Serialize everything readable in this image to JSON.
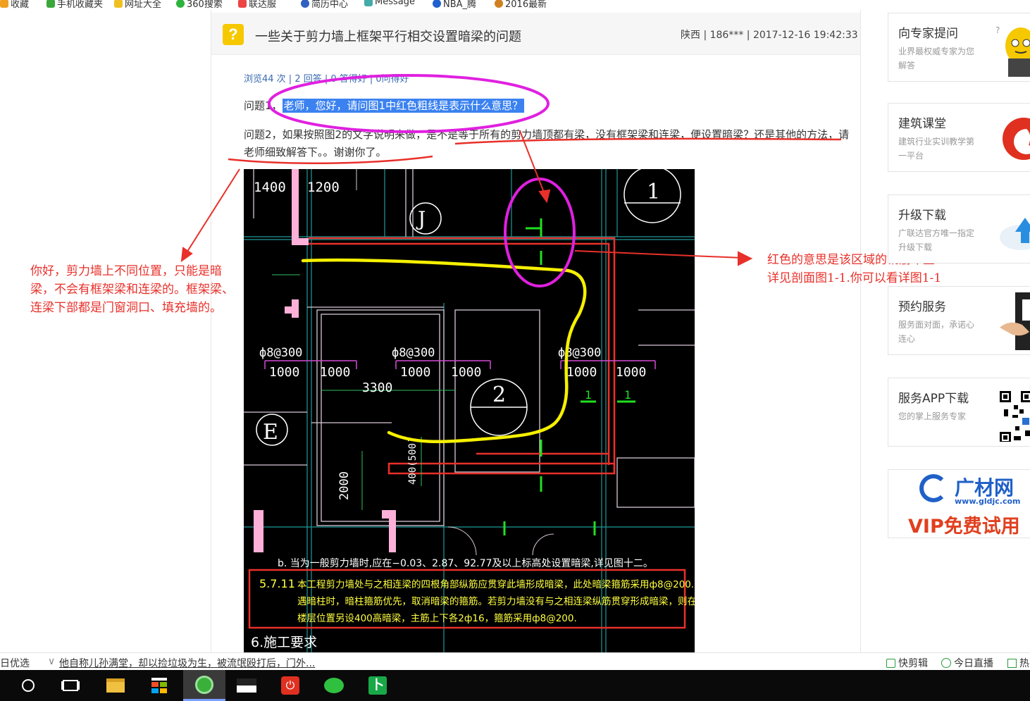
{
  "bookmarks": [
    {
      "label": "收藏",
      "color": "#f0a020"
    },
    {
      "label": "手机收藏夹",
      "color": "#3aa83a"
    },
    {
      "label": "网址大全",
      "color": "#f0c020"
    },
    {
      "label": "360搜索",
      "color": "#2db33d"
    },
    {
      "label": "联达服",
      "color": "#e44"
    },
    {
      "label": "简历中心",
      "color": "#3060c0"
    },
    {
      "label": "Message",
      "color": "#4aa"
    },
    {
      "label": "NBA_腾",
      "color": "#2060d0"
    },
    {
      "label": "2016最新",
      "color": "#d08020"
    }
  ],
  "question": {
    "icon": "?",
    "title": "一些关于剪力墙上框架平行相交设置暗梁的问题",
    "meta": "陕西 | 186*** | 2017-12-16 19:42:33",
    "stats": "浏览44 次 | 2 回答 | 0 答得好 | 0问得好",
    "q1_label": "问题1，",
    "q1_highlight": "老师，您好，请问图1中红色粗线是表示什么意思？",
    "q2_text": "问题2，如果按照图2的文字说明来做，是不是等于所有的剪力墙顶都有梁，没有框架梁和连梁，便设置暗梁？还是其他的方法，请老师细致解答下。。谢谢你了。"
  },
  "cad": {
    "dims_top": [
      "1400",
      "1200"
    ],
    "axis_labels": [
      "J",
      "E",
      "1",
      "2"
    ],
    "rebar": [
      "ф8@300",
      "ф8@300",
      "ф8@300"
    ],
    "dims_mid": [
      "1000",
      "1000",
      "1000",
      "1000",
      "1000",
      "1000"
    ],
    "dim_3300": "3300",
    "dim_2000": "2000",
    "dim_400": "400(500)",
    "section_marks": [
      "1",
      "1"
    ],
    "note_b": "b. 当为一般剪力墙时,应在−0.03、2.87、92.77及以上标高处设置暗梁,详见图十二。",
    "note_571_num": "5.7.11",
    "note_571_lines": [
      "本工程剪力墙处与之相连梁的四根角部纵筋应贯穿此墙形成暗梁，此处暗梁箍筋采用ф8@200.",
      "遇暗柱时，暗柱箍筋优先，取消暗梁的箍筋。若剪力墙没有与之相连梁纵筋贯穿形成暗梁，则在",
      "楼层位置另设400高暗梁，主筋上下各2ф16，箍筋采用ф8@200."
    ],
    "note_6": "6.施工要求"
  },
  "annotations": {
    "left": "你好，剪力墙上不同位置，只能是暗梁，不会有框架梁和连梁的。框架梁、连梁下部都是门窗洞口、填充墙的。",
    "right_line1": "红色的意思是该区域的钢筋布置",
    "right_line2": "详见剖面图1-1.你可以看详图1-1"
  },
  "sidebar": [
    {
      "title": "向专家提问",
      "desc": "业界最权威专家为您解答",
      "icon": "expert-mascot-icon",
      "accent": "#f6c800"
    },
    {
      "title": "建筑课堂",
      "desc": "建筑行业实训教学第一平台",
      "icon": "flame-logo-icon",
      "accent": "#e03020"
    },
    {
      "title": "升级下载",
      "desc": "广联达官方唯一指定升级下载",
      "icon": "cloud-upload-icon",
      "accent": "#2a8ee0"
    },
    {
      "title": "预约服务",
      "desc": "服务面对面，承诺心连心",
      "icon": "handshake-icon",
      "accent": "#222222"
    },
    {
      "title": "服务APP下载",
      "desc": "您的掌上服务专家",
      "icon": "qr-code-icon",
      "accent": "#000000"
    }
  ],
  "promo": {
    "brand": "广材网",
    "url": "www.gldjc.com",
    "slogan": "VIP免费试用"
  },
  "statusbar": {
    "left": "日优选",
    "news": "他自称儿孙满堂，却以捡垃圾为生，被流氓殴打后，门外...",
    "right_items": [
      "快剪辑",
      "今日直播",
      "热"
    ]
  },
  "colors": {
    "cad_bg": "#000000",
    "wall": "#ff6ad5",
    "red": "#e8302a",
    "yellow": "#f6f000",
    "green": "#20e020",
    "magenta_ellipse": "#e020e0",
    "cad_text": "#ffffff",
    "note_yellow": "#ffff40"
  }
}
